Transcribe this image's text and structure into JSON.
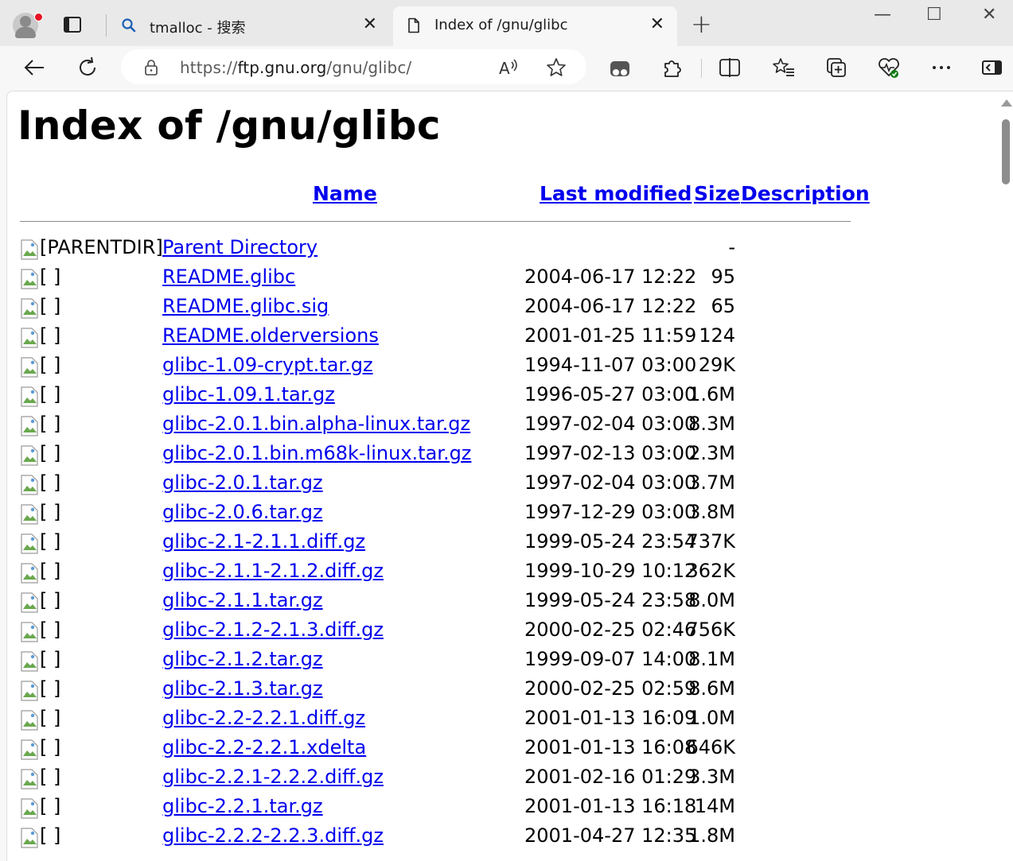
{
  "colors": {
    "link": "#0000ee",
    "tabbar": "#e9e9e9",
    "toolbar": "#f7f7f7",
    "notification": "#e81123"
  },
  "tabs": [
    {
      "title": "tmalloc - 搜索",
      "icon": "search-icon",
      "close": "✕"
    },
    {
      "title": "Index of /gnu/glibc",
      "icon": "page-icon",
      "close": "✕"
    }
  ],
  "newtab_label": "+",
  "window": {
    "minimize": "—",
    "maximize": "☐",
    "close": "✕"
  },
  "address": {
    "scheme": "https://",
    "host": "ftp.gnu.org",
    "path": "/gnu/glibc/"
  },
  "page": {
    "title": "Index of /gnu/glibc",
    "columns": {
      "name": "Name",
      "modified": "Last modified",
      "size": "Size",
      "description": "Description"
    },
    "parent": {
      "alt": "[PARENTDIR]",
      "name": "Parent Directory",
      "size": "-"
    },
    "rows": [
      {
        "alt": "[ ]",
        "name": "README.glibc",
        "date": "2004-06-17 12:22",
        "size": "95"
      },
      {
        "alt": "[ ]",
        "name": "README.glibc.sig",
        "date": "2004-06-17 12:22",
        "size": "65"
      },
      {
        "alt": "[ ]",
        "name": "README.olderversions",
        "date": "2001-01-25 11:59",
        "size": "124"
      },
      {
        "alt": "[ ]",
        "name": "glibc-1.09-crypt.tar.gz",
        "date": "1994-11-07 03:00",
        "size": "29K"
      },
      {
        "alt": "[ ]",
        "name": "glibc-1.09.1.tar.gz",
        "date": "1996-05-27 03:00",
        "size": "1.6M"
      },
      {
        "alt": "[ ]",
        "name": "glibc-2.0.1.bin.alpha-linux.tar.gz",
        "date": "1997-02-04 03:00",
        "size": "8.3M"
      },
      {
        "alt": "[ ]",
        "name": "glibc-2.0.1.bin.m68k-linux.tar.gz",
        "date": "1997-02-13 03:00",
        "size": "2.3M"
      },
      {
        "alt": "[ ]",
        "name": "glibc-2.0.1.tar.gz",
        "date": "1997-02-04 03:00",
        "size": "3.7M"
      },
      {
        "alt": "[ ]",
        "name": "glibc-2.0.6.tar.gz",
        "date": "1997-12-29 03:00",
        "size": "3.8M"
      },
      {
        "alt": "[ ]",
        "name": "glibc-2.1-2.1.1.diff.gz",
        "date": "1999-05-24 23:54",
        "size": "737K"
      },
      {
        "alt": "[ ]",
        "name": "glibc-2.1.1-2.1.2.diff.gz",
        "date": "1999-10-29 10:12",
        "size": "362K"
      },
      {
        "alt": "[ ]",
        "name": "glibc-2.1.1.tar.gz",
        "date": "1999-05-24 23:58",
        "size": "8.0M"
      },
      {
        "alt": "[ ]",
        "name": "glibc-2.1.2-2.1.3.diff.gz",
        "date": "2000-02-25 02:46",
        "size": "756K"
      },
      {
        "alt": "[ ]",
        "name": "glibc-2.1.2.tar.gz",
        "date": "1999-09-07 14:00",
        "size": "8.1M"
      },
      {
        "alt": "[ ]",
        "name": "glibc-2.1.3.tar.gz",
        "date": "2000-02-25 02:59",
        "size": "8.6M"
      },
      {
        "alt": "[ ]",
        "name": "glibc-2.2-2.2.1.diff.gz",
        "date": "2001-01-13 16:09",
        "size": "1.0M"
      },
      {
        "alt": "[ ]",
        "name": "glibc-2.2-2.2.1.xdelta",
        "date": "2001-01-13 16:08",
        "size": "646K"
      },
      {
        "alt": "[ ]",
        "name": "glibc-2.2.1-2.2.2.diff.gz",
        "date": "2001-02-16 01:29",
        "size": "3.3M"
      },
      {
        "alt": "[ ]",
        "name": "glibc-2.2.1.tar.gz",
        "date": "2001-01-13 16:18",
        "size": "14M"
      },
      {
        "alt": "[ ]",
        "name": "glibc-2.2.2-2.2.3.diff.gz",
        "date": "2001-04-27 12:35",
        "size": "1.8M"
      }
    ]
  }
}
